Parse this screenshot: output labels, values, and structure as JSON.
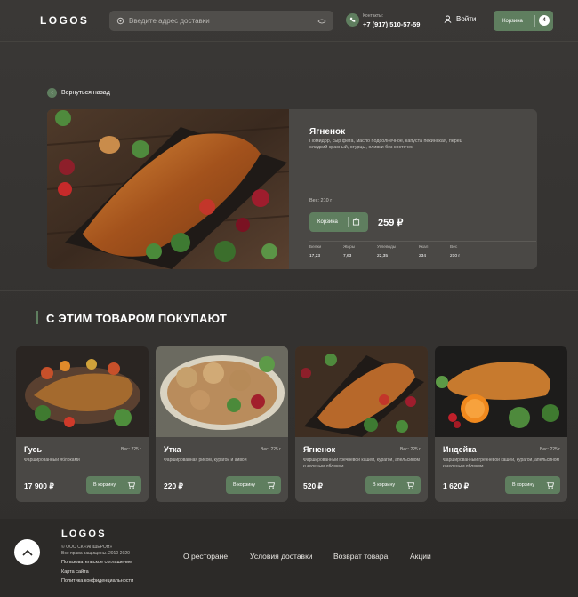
{
  "header": {
    "logo": "LOGOS",
    "search_placeholder": "Введите адрес доставки",
    "contacts_label": "Контакты:",
    "phone": "+7 (917) 510-57-59",
    "login_label": "Войти",
    "cart_label": "Корзина",
    "cart_count": "4"
  },
  "back_label": "Вернуться назад",
  "product": {
    "title": "Ягненок",
    "description": "Помидор, сыр фета, масло подсолнечное, капуста пекинская, перец сладкий красный, огурцы, оливки без косточек",
    "weight": "Вес: 210 г",
    "cart_label": "Корзина",
    "price": "259 ₽",
    "nutrition": [
      {
        "label": "Белки",
        "value": "17,23"
      },
      {
        "label": "Жиры",
        "value": "7,63"
      },
      {
        "label": "Углеводы",
        "value": "22,35"
      },
      {
        "label": "Ккал",
        "value": "234"
      },
      {
        "label": "Вес",
        "value": "210 г"
      }
    ]
  },
  "section_title": "С ЭТИМ ТОВАРОМ ПОКУПАЮТ",
  "cards": [
    {
      "name": "Гусь",
      "weight": "Вес: 225 г",
      "description": "Фаршированный яблоками",
      "price": "17 900 ₽",
      "button": "В корзину"
    },
    {
      "name": "Утка",
      "weight": "Вес: 225 г",
      "description": "Фаршированная рисом, курагой и айвой",
      "price": "220 ₽",
      "button": "В корзину"
    },
    {
      "name": "Ягненок",
      "weight": "Вес: 225 г",
      "description": "Фаршированный гречневой кашей, курагой, апельсином и зеленым яблоком",
      "price": "520 ₽",
      "button": "В корзину"
    },
    {
      "name": "Индейка",
      "weight": "Вес: 225 г",
      "description": "Фаршированный гречневой кашей, курагой, апельсином и зеленым яблоком",
      "price": "1 620 ₽",
      "button": "В корзину"
    }
  ],
  "footer": {
    "logo": "LOGOS",
    "company": "© ООО СК «АПШЕРОН»",
    "rights": "Все права защищены. 2010-2020",
    "links": [
      "Пользовательское соглашение",
      "Карта сайта",
      "Политика конфиденциальности"
    ],
    "nav": [
      "О ресторане",
      "Условия доставки",
      "Возврат товара",
      "Акции"
    ]
  },
  "colors": {
    "accent": "#5f7e5f",
    "background": "#353331",
    "card": "#4a4845",
    "footer": "#2c2a28"
  }
}
